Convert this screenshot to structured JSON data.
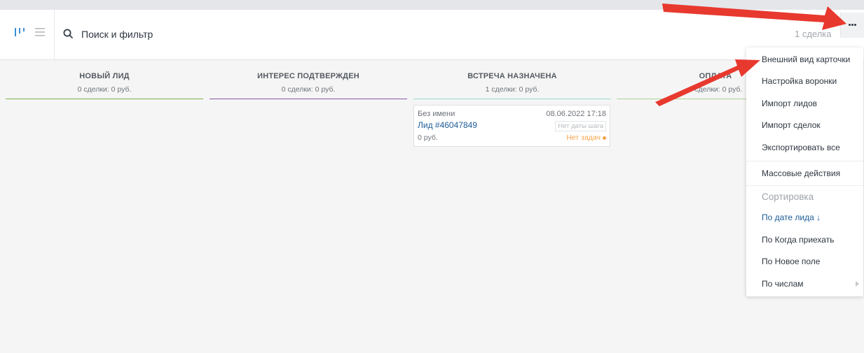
{
  "search": {
    "placeholder": "Поиск и фильтр"
  },
  "header": {
    "deals_count": "1 сделка"
  },
  "columns": [
    {
      "title": "НОВЫЙ ЛИД",
      "summary": "0 сделки: 0 руб.",
      "color": "#77b34a"
    },
    {
      "title": "ИНТЕРЕС ПОДТВЕРЖДЕН",
      "summary": "0 сделки: 0 руб.",
      "color": "#8a56a6"
    },
    {
      "title": "ВСТРЕЧА НАЗНАЧЕНА",
      "summary": "1 сделки: 0 руб.",
      "color": "#99d6cf"
    },
    {
      "title": "ОПЛАТА",
      "summary": "0 сделки: 0 руб.",
      "color": "#a9d18e"
    }
  ],
  "card": {
    "name": "Без имени",
    "datetime": "08.06.2022 17:18",
    "link": "Лид #46047849",
    "no_step_date": "Нет даты шага",
    "price": "0 руб.",
    "tasks": "Нет задач"
  },
  "menu": {
    "card_appearance": "Внешний вид карточки",
    "funnel_settings": "Настройка воронки",
    "import_leads": "Импорт лидов",
    "import_deals": "Импорт сделок",
    "export_all": "Экспортировать все",
    "bulk_actions": "Массовые действия",
    "sort_heading": "Сортировка",
    "sort_by_lead_date": "По дате лида ↓",
    "sort_by_arrival": "По Когда приехать",
    "sort_by_new_field": "По Новое поле",
    "sort_by_numbers": "По числам"
  },
  "colors": {
    "accent": "#1c5c99",
    "annotation_arrow": "#e8392f",
    "task_warning": "#f5a44a"
  }
}
